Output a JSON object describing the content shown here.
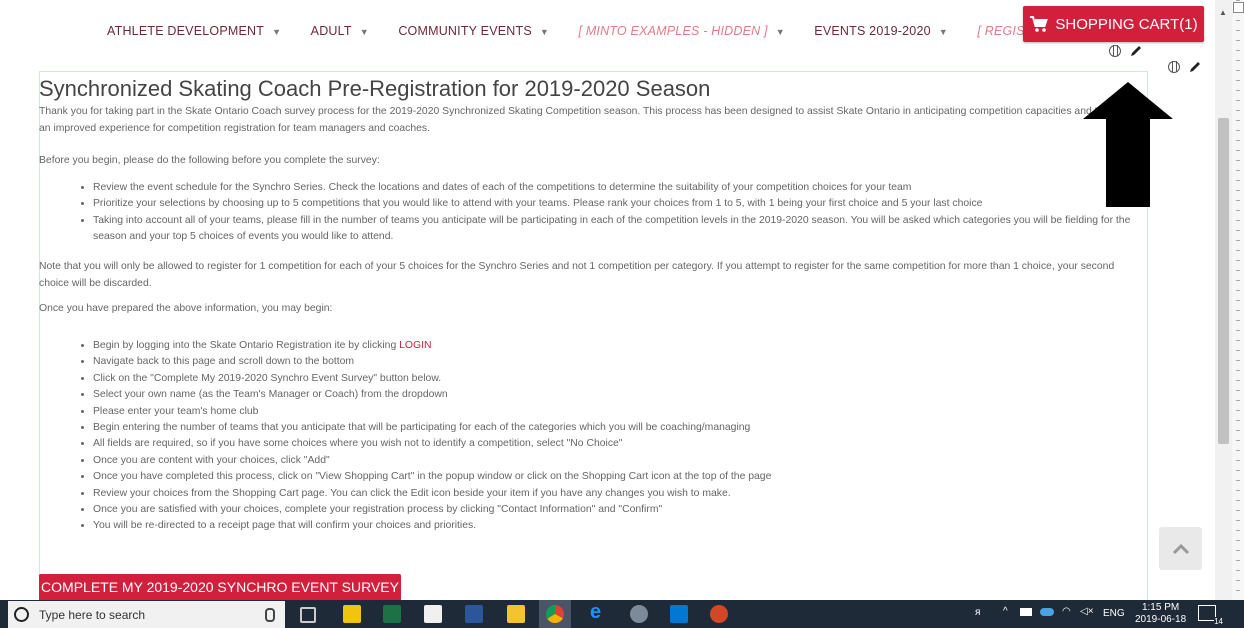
{
  "nav": {
    "items": [
      {
        "label": "ATHLETE DEVELOPMENT",
        "hidden": false
      },
      {
        "label": "ADULT",
        "hidden": false
      },
      {
        "label": "COMMUNITY EVENTS",
        "hidden": false
      },
      {
        "label": "[ MINTO EXAMPLES - HIDDEN ]",
        "hidden": true
      },
      {
        "label": "EVENTS 2019-2020",
        "hidden": false
      },
      {
        "label": "[ REGISTRAT",
        "hidden": true
      }
    ],
    "cart_label": "SHOPPING CART(1)"
  },
  "page": {
    "title": "Synchronized Skating Coach Pre-Registration for 2019-2020 Season",
    "intro": "Thank you for taking part in the Skate Ontario Coach survey process for the 2019-2020 Synchronized Skating Competition season. This process has been designed to assist Skate Ontario in anticipating competition capacities and to provide an improved experience for competition registration for team managers and coaches.",
    "before_begin": "Before you begin, please do the following before you complete the survey:",
    "prep_items": [
      "Review the event schedule for the Synchro Series. Check the locations and dates of each of the competitions to determine the suitability of your competition choices for your team",
      "Prioritize your selections by choosing up to 5 competitions that you would like to attend with your teams. Please rank your choices from 1 to 5, with 1 being your first choice and 5 your last choice",
      "Taking into account all of your teams, please fill in the number of teams you anticipate will be participating in each of the competition levels in the 2019-2020 season. You will be asked which categories you will be fielding for the season and your top 5 choices of events you would like to attend."
    ],
    "note": "Note that you will only be allowed to register for 1 competition for each of your 5 choices for the Synchro Series and not 1 competition per category. If you attempt to register for the same competition for more than 1 choice, your second choice will be discarded.",
    "once_prepared": "Once you have prepared the above information, you may begin:",
    "step1_prefix": "Begin by logging into the Skate Ontario Registration ite by clicking ",
    "step1_link": "LOGIN",
    "steps": [
      "Navigate back to this page and scroll down to the bottom",
      "Click on the \"Complete My 2019-2020 Synchro Event Survey\" button below.",
      "Select your own name (as the Team's Manager or Coach) from the dropdown",
      "Please enter your team's home club",
      "Begin entering the number of teams that you anticipate that will be participating for each of the categories which you will be coaching/managing",
      "All fields are required, so if you have some choices where you wish not to identify a competition, select \"No Choice\"",
      "Once you are content with your choices, click \"Add\"",
      "Once you have completed this process, click on \"View Shopping Cart\" in the popup window or click on the Shopping Cart icon at the top of the page",
      "Review your choices from the Shopping Cart page. You can click the Edit icon beside your item if you have any changes you wish to make.",
      "Once you are satisfied with your choices, complete your registration process by clicking \"Contact Information\" and \"Confirm\"",
      "You will be re-directed to a receipt page that will confirm your choices and priorities."
    ],
    "survey_button": "COMPLETE MY 2019-2020 SYNCHRO EVENT SURVEY"
  },
  "taskbar": {
    "search_placeholder": "Type here to search",
    "tray_lang": "ENG",
    "time": "1:15 PM",
    "date": "2019-06-18",
    "notif_count": "14"
  },
  "colors": {
    "accent": "#d21f3c",
    "taskbar": "#1f2a38"
  }
}
